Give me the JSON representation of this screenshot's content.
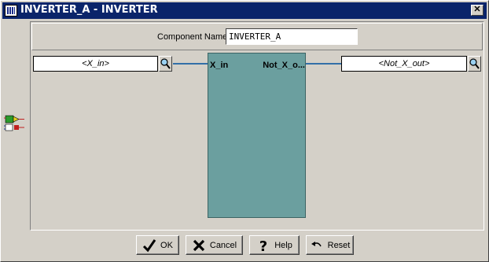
{
  "window": {
    "title": "INVERTER_A - INVERTER",
    "close_glyph": "✕",
    "app_icon": "app-icon"
  },
  "component_name": {
    "label": "Component Name",
    "value": "INVERTER_A"
  },
  "pins": {
    "input_placeholder": "<X_in>",
    "output_placeholder": "<Not_X_out>",
    "input_label": "X_in",
    "output_label": "Not_X_o..."
  },
  "buttons": {
    "ok": "OK",
    "cancel": "Cancel",
    "help": "Help",
    "reset": "Reset"
  },
  "colors": {
    "titlebar": "#0a246a",
    "component_fill": "#6b9f9f",
    "wire": "#336fa8"
  }
}
